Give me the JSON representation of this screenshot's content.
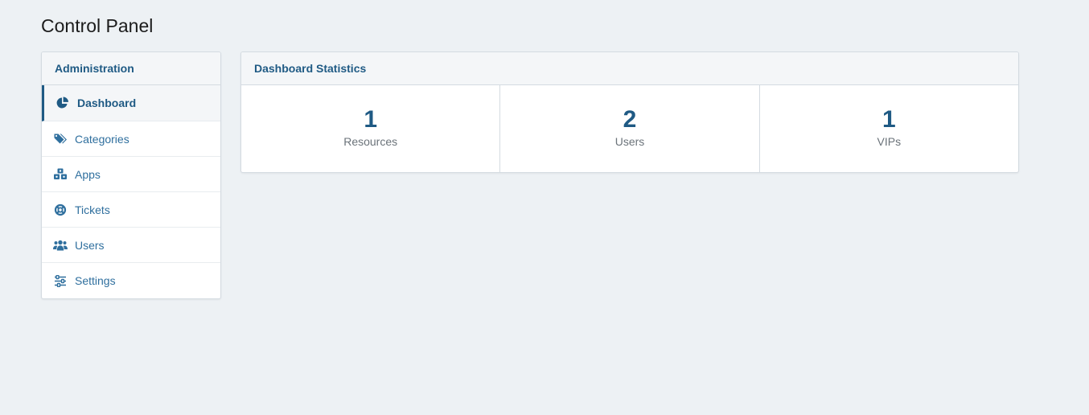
{
  "page": {
    "title": "Control Panel"
  },
  "sidebar": {
    "header": "Administration",
    "items": [
      {
        "label": "Dashboard",
        "icon": "pie-chart-icon",
        "active": true
      },
      {
        "label": "Categories",
        "icon": "tags-icon",
        "active": false
      },
      {
        "label": "Apps",
        "icon": "cubes-icon",
        "active": false
      },
      {
        "label": "Tickets",
        "icon": "life-ring-icon",
        "active": false
      },
      {
        "label": "Users",
        "icon": "users-icon",
        "active": false
      },
      {
        "label": "Settings",
        "icon": "sliders-icon",
        "active": false
      }
    ]
  },
  "stats": {
    "header": "Dashboard Statistics",
    "cells": [
      {
        "value": "1",
        "label": "Resources"
      },
      {
        "value": "2",
        "label": "Users"
      },
      {
        "value": "1",
        "label": "VIPs"
      }
    ]
  },
  "colors": {
    "accent": "#1f5a84",
    "link": "#2f6f9e",
    "background": "#edf1f4",
    "muted_text": "#6b737a"
  }
}
